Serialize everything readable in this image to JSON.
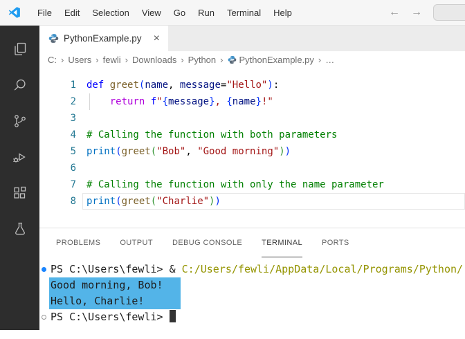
{
  "titlebar": {
    "menu_items": [
      "File",
      "Edit",
      "Selection",
      "View",
      "Go",
      "Run",
      "Terminal",
      "Help"
    ],
    "back_arrow": "←",
    "forward_arrow": "→"
  },
  "tab": {
    "label": "PythonExample.py",
    "close_label": "×"
  },
  "breadcrumb": {
    "separator": "›",
    "items": [
      {
        "label": "C:"
      },
      {
        "label": "Users"
      },
      {
        "label": "fewli"
      },
      {
        "label": "Downloads"
      },
      {
        "label": "Python"
      },
      {
        "label": "PythonExample.py",
        "icon": "python"
      },
      {
        "label": "…"
      }
    ]
  },
  "editor": {
    "lines": [
      {
        "num": "1",
        "tokens": [
          {
            "t": "def",
            "c": "kw"
          },
          {
            "t": " ",
            "c": "plain"
          },
          {
            "t": "greet",
            "c": "fn"
          },
          {
            "t": "(",
            "c": "b1"
          },
          {
            "t": "name",
            "c": "param"
          },
          {
            "t": ", ",
            "c": "plain"
          },
          {
            "t": "message",
            "c": "param"
          },
          {
            "t": "=",
            "c": "plain"
          },
          {
            "t": "\"Hello\"",
            "c": "str"
          },
          {
            "t": ")",
            "c": "b1"
          },
          {
            "t": ":",
            "c": "plain"
          }
        ]
      },
      {
        "num": "2",
        "tokens": [
          {
            "t": "    ",
            "c": "plain"
          },
          {
            "t": "return",
            "c": "ctrl"
          },
          {
            "t": " ",
            "c": "plain"
          },
          {
            "t": "f",
            "c": "kw"
          },
          {
            "t": "\"",
            "c": "str"
          },
          {
            "t": "{",
            "c": "b1"
          },
          {
            "t": "message",
            "c": "param"
          },
          {
            "t": "}",
            "c": "b1"
          },
          {
            "t": ", ",
            "c": "str"
          },
          {
            "t": "{",
            "c": "b1"
          },
          {
            "t": "name",
            "c": "param"
          },
          {
            "t": "}",
            "c": "b1"
          },
          {
            "t": "!\"",
            "c": "str"
          }
        ]
      },
      {
        "num": "3",
        "tokens": []
      },
      {
        "num": "4",
        "tokens": [
          {
            "t": "# Calling the function with both parameters",
            "c": "com"
          }
        ]
      },
      {
        "num": "5",
        "tokens": [
          {
            "t": "print",
            "c": "builtin"
          },
          {
            "t": "(",
            "c": "b1"
          },
          {
            "t": "greet",
            "c": "fn"
          },
          {
            "t": "(",
            "c": "b2"
          },
          {
            "t": "\"Bob\"",
            "c": "str"
          },
          {
            "t": ", ",
            "c": "plain"
          },
          {
            "t": "\"Good morning\"",
            "c": "str"
          },
          {
            "t": ")",
            "c": "b2"
          },
          {
            "t": ")",
            "c": "b1"
          }
        ]
      },
      {
        "num": "6",
        "tokens": []
      },
      {
        "num": "7",
        "tokens": [
          {
            "t": "# Calling the function with only the name parameter",
            "c": "com"
          }
        ]
      },
      {
        "num": "8",
        "current": true,
        "tokens": [
          {
            "t": "print",
            "c": "builtin"
          },
          {
            "t": "(",
            "c": "b1"
          },
          {
            "t": "greet",
            "c": "fn"
          },
          {
            "t": "(",
            "c": "b2"
          },
          {
            "t": "\"Charlie\"",
            "c": "str"
          },
          {
            "t": ")",
            "c": "b2"
          },
          {
            "t": ")",
            "c": "b1"
          }
        ]
      }
    ]
  },
  "panel": {
    "tabs": [
      {
        "label": "PROBLEMS",
        "active": false
      },
      {
        "label": "OUTPUT",
        "active": false
      },
      {
        "label": "DEBUG CONSOLE",
        "active": false
      },
      {
        "label": "TERMINAL",
        "active": true
      },
      {
        "label": "PORTS",
        "active": false
      }
    ]
  },
  "terminal": {
    "lines": [
      {
        "decoration": "filled",
        "tokens": [
          {
            "t": "PS C:\\Users\\fewli> ",
            "c": "tfg"
          },
          {
            "t": "& ",
            "c": "tfg"
          },
          {
            "t": "C:/Users/fewli/AppData/Local/Programs/Python/",
            "c": "cmd"
          }
        ]
      },
      {
        "selected": true,
        "tokens": [
          {
            "t": "Good morning, Bob!",
            "c": "tfg"
          }
        ]
      },
      {
        "selected": true,
        "tokens": [
          {
            "t": "Hello, Charlie!",
            "c": "tfg"
          }
        ]
      },
      {
        "decoration": "hollow",
        "cursor": true,
        "tokens": [
          {
            "t": "PS C:\\Users\\fewli> ",
            "c": "tfg"
          }
        ]
      }
    ]
  },
  "colors": {
    "keyword": "#0000ff",
    "control": "#af00db",
    "function": "#795e26",
    "parameter": "#001080",
    "string": "#a31515",
    "comment": "#008000",
    "bracket1": "#0431fa",
    "bracket2": "#319331",
    "builtin": "#0070c1",
    "editor_fg": "#000000",
    "line_number": "#237893",
    "terminal_fg": "#1e1e1e",
    "terminal_command": "#949400",
    "terminal_selection": "#53b4e8",
    "command_decoration": "#1a85ff",
    "activity_bar_bg": "#2d2d2d",
    "titlebar_bg": "#f6f6f6",
    "tabstrip_bg": "#ececec",
    "python_icon_blue": "#4293c9",
    "python_icon_dark": "#5b6a79"
  }
}
